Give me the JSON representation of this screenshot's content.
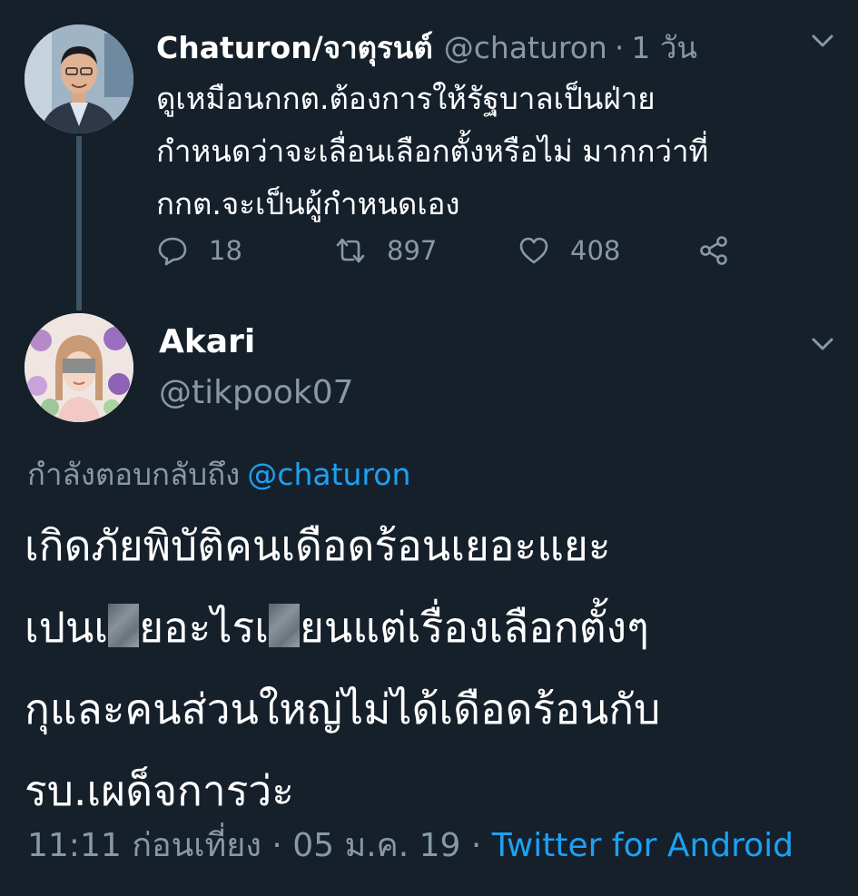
{
  "parent_tweet": {
    "name": "Chaturon/จาตุรนต์",
    "handle": "@chaturon",
    "separator": "·",
    "time": "1 วัน",
    "lines": [
      "ดูเหมือนกกต.ต้องการให้รัฐบาลเป็นฝ่าย",
      "กำหนดว่าจะเลื่อนเลือกตั้งหรือไม่ มากกว่าที่",
      "กกต.จะเป็นผู้กำหนดเอง"
    ],
    "replies": "18",
    "retweets": "897",
    "likes": "408"
  },
  "reply_tweet": {
    "name": "Akari",
    "handle": "@tikpook07",
    "replying_to_label": "กำลังตอบกลับถึง",
    "replying_to_handle": "@chaturon",
    "line1": "เกิดภัยพิบัติคนเดือดร้อนเยอะแยะ",
    "line2_a": "เปนเ",
    "line2_b": "ยอะไรเ",
    "line2_c": "ยนแต่เรื่องเลือกตั้งๆ",
    "line3": "กุและคนส่วนใหญ่ไม่ได้เดือดร้อนกับ",
    "line4": "รบ.เผด็จการว่ะ",
    "timestamp": "11:11 ก่อนเที่ยง · 05 ม.ค. 19 ·",
    "source": "Twitter for Android"
  },
  "icons": {
    "menu": "chevron-down-icon",
    "reply": "reply-icon",
    "retweet": "retweet-icon",
    "like": "heart-icon",
    "share": "share-icon"
  },
  "colors": {
    "background": "#15202b",
    "secondary_text": "#8899a6",
    "link": "#1da1f2",
    "thread_line": "#3d5466"
  }
}
